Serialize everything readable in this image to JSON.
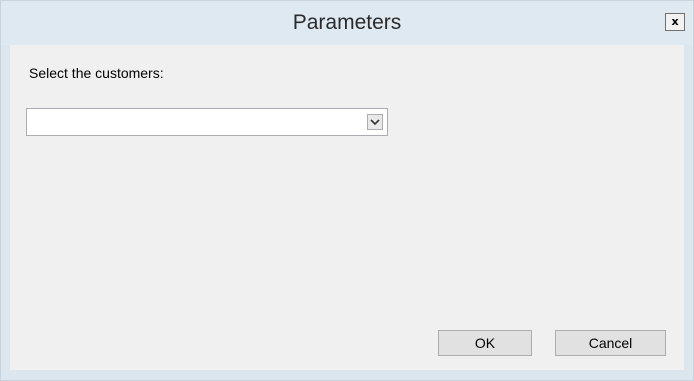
{
  "dialog": {
    "title": "Parameters",
    "close_label": "x"
  },
  "form": {
    "prompt_label": "Select the customers:",
    "customers_select": {
      "value": ""
    }
  },
  "actions": {
    "ok_label": "OK",
    "cancel_label": "Cancel"
  },
  "icons": {
    "dropdown": "chevron-down-icon",
    "close": "close-icon"
  }
}
